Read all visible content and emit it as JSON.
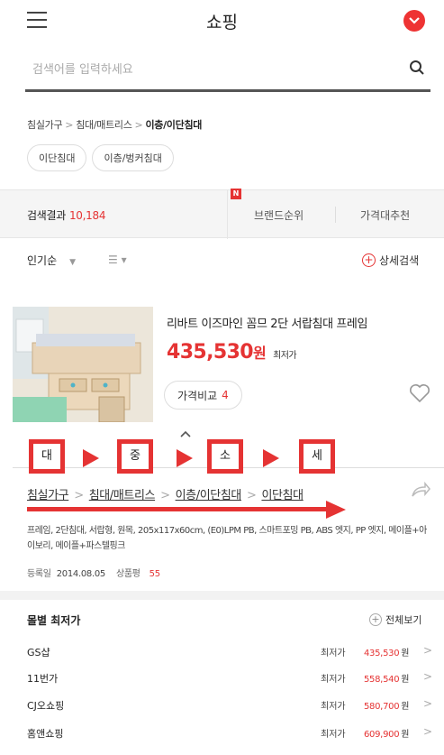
{
  "header": {
    "title": "쇼핑",
    "menu_icon": "hamburger-icon",
    "profile_icon": "chevron-down-icon",
    "accent": "#e53333"
  },
  "search": {
    "placeholder": "검색어를 입력하세요",
    "value": ""
  },
  "category_path": [
    "침실가구",
    "침대/매트리스",
    "이층/이단침대"
  ],
  "chips": [
    "이단침대",
    "이층/벙커침대"
  ],
  "tabs": {
    "result_label": "검색결과",
    "result_count": "10,184",
    "new_badge": "N",
    "brand": "브랜드순위",
    "price": "가격대추천"
  },
  "sort": {
    "popular": "인기순",
    "popular_arrow": "▼",
    "view": "☰ ▾",
    "detail": "상세검색"
  },
  "product": {
    "name": "리바트 이즈마인 꼼므 2단 서랍침대 프레임",
    "price": "435,530",
    "won": "원",
    "min_label": "최저가",
    "compare_label": "가격비교",
    "compare_count": "4"
  },
  "annotations": [
    "대",
    "중",
    "소",
    "세"
  ],
  "category_full": [
    "침실가구",
    "침대/매트리스",
    "이층/이단침대",
    "이단침대"
  ],
  "spec": "프레임, 2단침대, 서랍형, 원목, 205x117x60cm, (E0)LPM PB, 스마트포밍 PB, ABS 엣지, PP 엣지, 메이플+아이보리, 메이플+파스텔핑크",
  "registration": {
    "date_label": "등록일",
    "date": "2014.08.05",
    "review_label": "상품평",
    "review_count": "55"
  },
  "mall": {
    "title": "몰별 최저가",
    "view_all": "전체보기",
    "rows": [
      {
        "name": "GS샵",
        "label": "최저가",
        "price": "435,530",
        "won": "원"
      },
      {
        "name": "11번가",
        "label": "최저가",
        "price": "558,540",
        "won": "원"
      },
      {
        "name": "CJ오쇼핑",
        "label": "최저가",
        "price": "580,700",
        "won": "원"
      },
      {
        "name": "홈앤쇼핑",
        "label": "최저가",
        "price": "609,900",
        "won": "원"
      }
    ]
  }
}
